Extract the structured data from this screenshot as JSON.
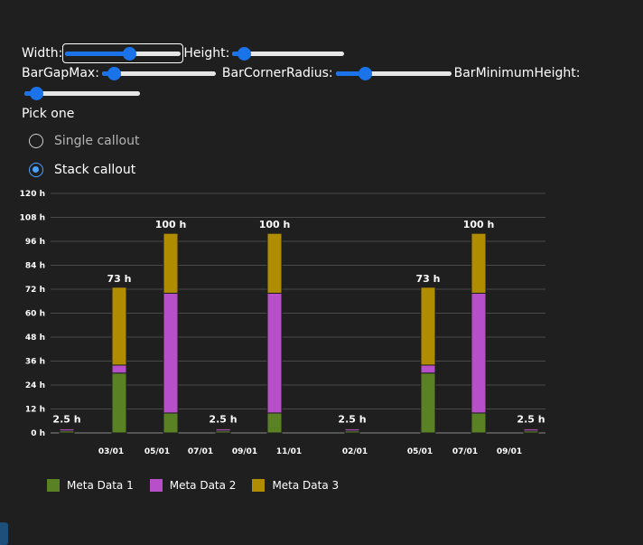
{
  "controls": {
    "width_label": "Width:",
    "height_label": "Height:",
    "bar_gap_max_label": "BarGapMax:",
    "bar_corner_radius_label": "BarCornerRadius:",
    "bar_minimum_height_label": "BarMinimumHeight:",
    "width_value": 0.55,
    "height_value": 0.1,
    "bar_gap_max_value": 0.1,
    "bar_corner_radius_value": 0.25,
    "bar_minimum_height_value": 0.1
  },
  "callout": {
    "pick_label": "Pick one",
    "options": [
      {
        "label": "Single callout",
        "selected": false
      },
      {
        "label": "Stack callout",
        "selected": true
      }
    ]
  },
  "colors": {
    "series1": "#5a8225",
    "series2": "#b64fc8",
    "series3": "#b08d00",
    "accent": "#1a73e8",
    "radio_accent": "#4aa3ff"
  },
  "chart_data": {
    "type": "bar",
    "stacked": true,
    "ylim": [
      0,
      120
    ],
    "yticks": [
      "0 h",
      "12 h",
      "24 h",
      "36 h",
      "48 h",
      "60 h",
      "72 h",
      "84 h",
      "96 h",
      "108 h",
      "120 h"
    ],
    "xticks": [
      "03/01",
      "05/01",
      "07/01",
      "09/01",
      "11/01",
      "02/01",
      "05/01",
      "07/01",
      "09/01"
    ],
    "series": [
      {
        "name": "Meta Data 1",
        "values": [
          1,
          30,
          10,
          1,
          10,
          1,
          30,
          10,
          1
        ]
      },
      {
        "name": "Meta Data 2",
        "values": [
          1,
          4,
          60,
          1,
          60,
          1,
          4,
          60,
          1
        ]
      },
      {
        "name": "Meta Data 3",
        "values": [
          0.5,
          39,
          30,
          0.5,
          30,
          0.5,
          39,
          30,
          0.5
        ]
      }
    ],
    "totals": [
      "2.5 h",
      "73 h",
      "100 h",
      "2.5 h",
      "100 h",
      "2.5 h",
      "73 h",
      "100 h",
      "2.5 h"
    ],
    "grid": true,
    "legend_position": "bottom-left"
  }
}
